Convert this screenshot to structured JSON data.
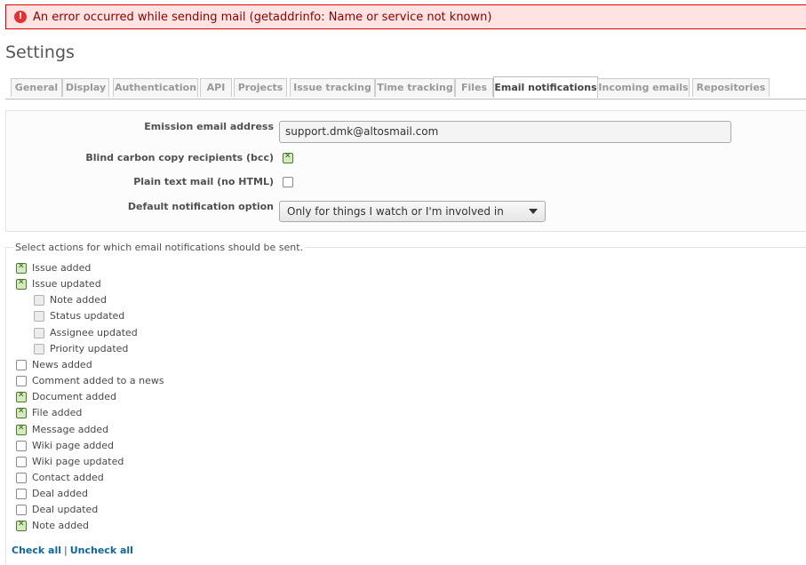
{
  "flash": {
    "message": "An error occurred while sending mail (getaddrinfo: Name or service not known)",
    "icon": "error-icon"
  },
  "page": {
    "title": "Settings"
  },
  "tabs": [
    {
      "label": "General"
    },
    {
      "label": "Display"
    },
    {
      "label": "Authentication"
    },
    {
      "label": "API"
    },
    {
      "label": "Projects"
    },
    {
      "label": "Issue tracking"
    },
    {
      "label": "Time tracking"
    },
    {
      "label": "Files"
    },
    {
      "label": "Email notifications",
      "selected": true
    },
    {
      "label": "Incoming emails"
    },
    {
      "label": "Repositories"
    }
  ],
  "form": {
    "emission_label": "Emission email address",
    "emission_value": "support.dmk@altosmail.com",
    "bcc_label": "Blind carbon copy recipients (bcc)",
    "bcc_checked": true,
    "plain_label": "Plain text mail (no HTML)",
    "plain_checked": false,
    "default_label": "Default notification option",
    "default_value": "Only for things I watch or I'm involved in"
  },
  "notifications": {
    "legend": "Select actions for which email notifications should be sent.",
    "items": [
      {
        "label": "Issue added",
        "checked": true
      },
      {
        "label": "Issue updated",
        "checked": true
      },
      {
        "label": "Note added",
        "checked": false,
        "sub": true
      },
      {
        "label": "Status updated",
        "checked": false,
        "sub": true
      },
      {
        "label": "Assignee updated",
        "checked": false,
        "sub": true
      },
      {
        "label": "Priority updated",
        "checked": false,
        "sub": true
      },
      {
        "label": "News added",
        "checked": false
      },
      {
        "label": "Comment added to a news",
        "checked": false
      },
      {
        "label": "Document added",
        "checked": true
      },
      {
        "label": "File added",
        "checked": true
      },
      {
        "label": "Message added",
        "checked": true
      },
      {
        "label": "Wiki page added",
        "checked": false
      },
      {
        "label": "Wiki page updated",
        "checked": false
      },
      {
        "label": "Contact added",
        "checked": false
      },
      {
        "label": "Deal added",
        "checked": false
      },
      {
        "label": "Deal updated",
        "checked": false
      },
      {
        "label": "Note added",
        "checked": true
      }
    ],
    "check_all": "Check all",
    "uncheck_all": "Uncheck all",
    "separator": "|"
  }
}
